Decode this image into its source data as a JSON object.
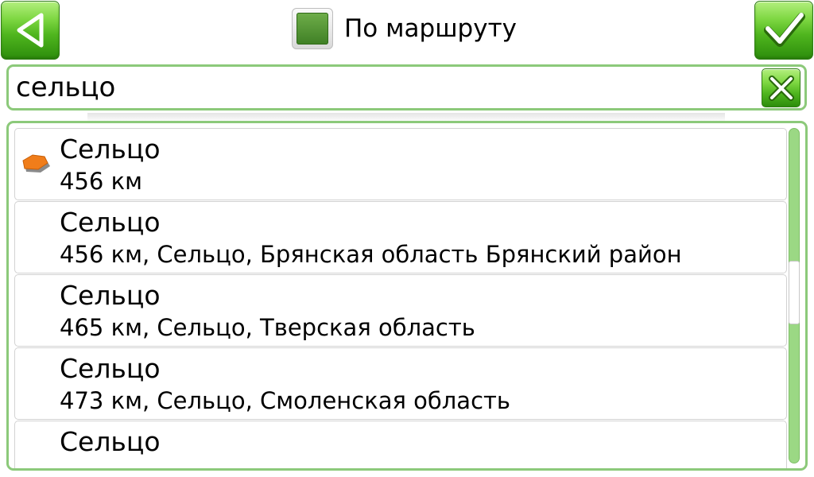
{
  "header": {
    "route_label": "По маршруту",
    "route_checked": true
  },
  "search": {
    "value": "сельцо"
  },
  "results": [
    {
      "name": "Сельцо",
      "detail": "456 км",
      "icon": "poi-marker-icon"
    },
    {
      "name": "Сельцо",
      "detail": "456 км, Сельцо, Брянская область Брянский район"
    },
    {
      "name": "Сельцо",
      "detail": "465 км, Сельцо, Тверская область"
    },
    {
      "name": "Сельцо",
      "detail": "473 км, Сельцо, Смоленская область"
    },
    {
      "name": "Сельцо",
      "detail": ""
    }
  ],
  "colors": {
    "accent_green": "#4fb51e",
    "frame_green": "#8cc97a",
    "marker_orange": "#f07d1a"
  }
}
